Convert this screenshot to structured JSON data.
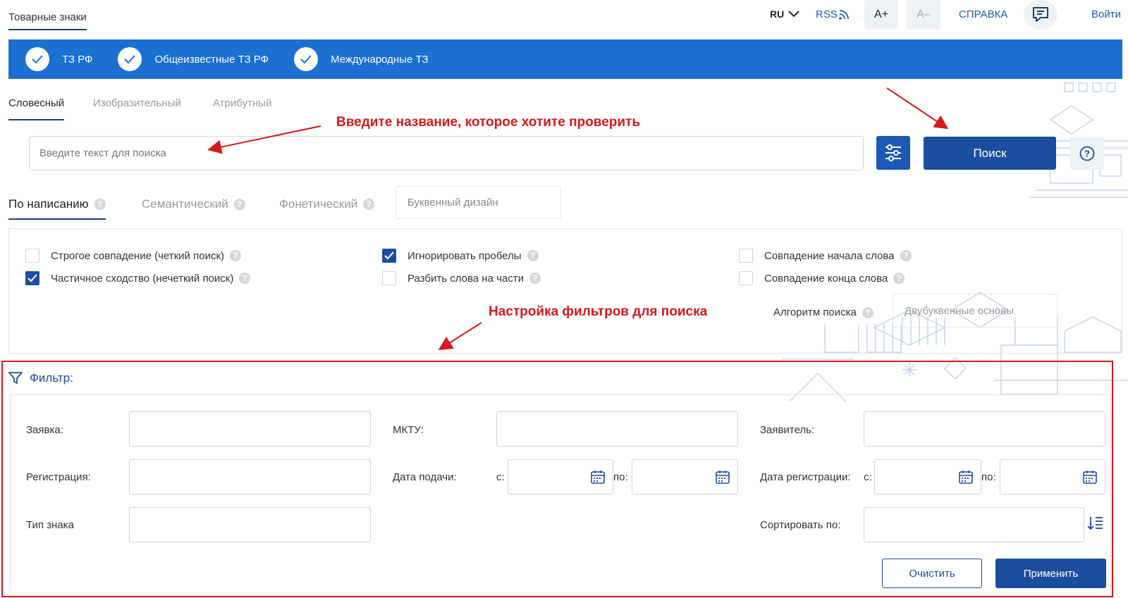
{
  "header": {
    "brand": "Товарные знаки",
    "lang": "RU",
    "rss": "RSS",
    "font_increase": "A+",
    "font_decrease": "A–",
    "help": "СПРАВКА",
    "login": "Войти"
  },
  "databases": [
    {
      "label": "ТЗ РФ"
    },
    {
      "label": "Общеизвестные ТЗ РФ"
    },
    {
      "label": "Международные ТЗ"
    }
  ],
  "search_tabs": [
    {
      "label": "Словесный",
      "active": true
    },
    {
      "label": "Изобразительный",
      "active": false
    },
    {
      "label": "Атрибутный",
      "active": false
    }
  ],
  "search": {
    "placeholder": "Введите текст для поиска",
    "button": "Поиск"
  },
  "modes": [
    {
      "label": "По написанию",
      "active": true
    },
    {
      "label": "Семантический",
      "active": false
    },
    {
      "label": "Фонетический",
      "active": false
    }
  ],
  "letter_design": "Буквенный дизайн",
  "options": {
    "col1": [
      {
        "label": "Строгое совпадение (четкий поиск)",
        "checked": false
      },
      {
        "label": "Частичное сходство (нечеткий поиск)",
        "checked": true
      }
    ],
    "col2": [
      {
        "label": "Игнорировать пробелы",
        "checked": true
      },
      {
        "label": "Разбить слова на части",
        "checked": false
      }
    ],
    "col3": [
      {
        "label": "Совпадение начала слова",
        "checked": false
      },
      {
        "label": "Совпадение конца слова",
        "checked": false
      }
    ],
    "algorithm_label": "Алгоритм поиска",
    "algorithm_value": "Двубуквенные основы"
  },
  "annotations": {
    "enter_name": "Введите название, которое хотите проверить",
    "filters": "Настройка фильтров для поиска"
  },
  "filter": {
    "title": "Фильтр:",
    "application": "Заявка:",
    "mktu": "МКТУ:",
    "applicant": "Заявитель:",
    "registration": "Регистрация:",
    "filing_date": "Дата подачи:",
    "registration_date": "Дата регистрации:",
    "from": "с:",
    "to": "по:",
    "mark_type": "Тип знака",
    "sort_by": "Сортировать по:",
    "clear": "Очистить",
    "apply": "Применить"
  },
  "colors": {
    "primary": "#1b4e9e",
    "bar": "#1b6fd1",
    "annotation": "#d6191b"
  }
}
